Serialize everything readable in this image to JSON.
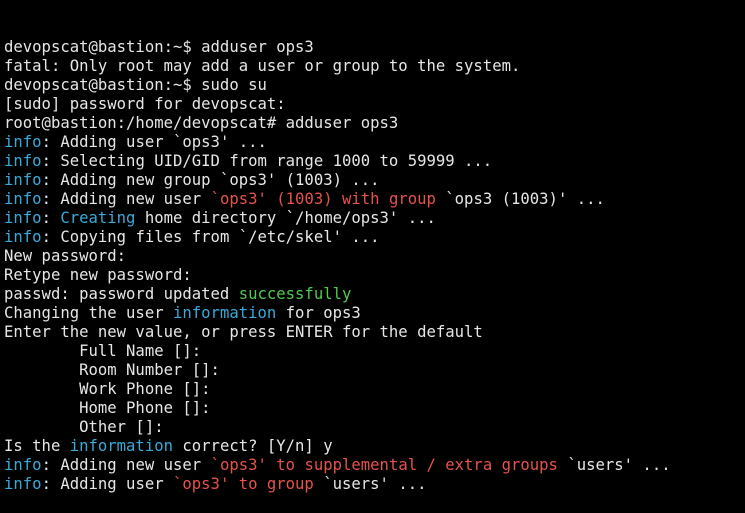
{
  "colors": {
    "background": "#000000",
    "default": "#e6e6e6",
    "info": "#3aa9d8",
    "red": "#e5534b",
    "green": "#4fc94f"
  },
  "lines": [
    [
      {
        "text": "devopscat@bastion:~$ adduser ops3",
        "c": "default"
      }
    ],
    [
      {
        "text": "fatal: Only root may add a user or group to the system.",
        "c": "default"
      }
    ],
    [
      {
        "text": "devopscat@bastion:~$ sudo su",
        "c": "default"
      }
    ],
    [
      {
        "text": "[sudo] password for devopscat:",
        "c": "default"
      }
    ],
    [
      {
        "text": "root@bastion:/home/devopscat# adduser ops3",
        "c": "default"
      }
    ],
    [
      {
        "text": "info",
        "c": "info"
      },
      {
        "text": ": Adding user `ops3' ...",
        "c": "default"
      }
    ],
    [
      {
        "text": "info",
        "c": "info"
      },
      {
        "text": ": Selecting UID/GID from range 1000 to 59999 ...",
        "c": "default"
      }
    ],
    [
      {
        "text": "info",
        "c": "info"
      },
      {
        "text": ": Adding new group `ops3' (1003) ...",
        "c": "default"
      }
    ],
    [
      {
        "text": "info",
        "c": "info"
      },
      {
        "text": ": Adding new user ",
        "c": "default"
      },
      {
        "text": "`ops3' (1003) with group ",
        "c": "red"
      },
      {
        "text": "`ops3 (1003)' ...",
        "c": "default"
      }
    ],
    [
      {
        "text": "info",
        "c": "info"
      },
      {
        "text": ": ",
        "c": "default"
      },
      {
        "text": "Creating",
        "c": "info"
      },
      {
        "text": " home directory `/home/ops3' ...",
        "c": "default"
      }
    ],
    [
      {
        "text": "info",
        "c": "info"
      },
      {
        "text": ": Copying files from `/etc/skel' ...",
        "c": "default"
      }
    ],
    [
      {
        "text": "New password:",
        "c": "default"
      }
    ],
    [
      {
        "text": "Retype new password:",
        "c": "default"
      }
    ],
    [
      {
        "text": "passwd: password updated ",
        "c": "default"
      },
      {
        "text": "successfully",
        "c": "green"
      }
    ],
    [
      {
        "text": "Changing the user ",
        "c": "default"
      },
      {
        "text": "information",
        "c": "info"
      },
      {
        "text": " for ops3",
        "c": "default"
      }
    ],
    [
      {
        "text": "Enter the new value, or press ENTER for the default",
        "c": "default"
      }
    ],
    [
      {
        "text": "        Full Name []:",
        "c": "default"
      }
    ],
    [
      {
        "text": "        Room Number []:",
        "c": "default"
      }
    ],
    [
      {
        "text": "        Work Phone []:",
        "c": "default"
      }
    ],
    [
      {
        "text": "        Home Phone []:",
        "c": "default"
      }
    ],
    [
      {
        "text": "        Other []:",
        "c": "default"
      }
    ],
    [
      {
        "text": "Is the ",
        "c": "default"
      },
      {
        "text": "information",
        "c": "info"
      },
      {
        "text": " correct? [Y/n] y",
        "c": "default"
      }
    ],
    [
      {
        "text": "info",
        "c": "info"
      },
      {
        "text": ": Adding new user ",
        "c": "default"
      },
      {
        "text": "`ops3' to supplemental / extra groups ",
        "c": "red"
      },
      {
        "text": "`users' ...",
        "c": "default"
      }
    ],
    [
      {
        "text": "info",
        "c": "info"
      },
      {
        "text": ": Adding user ",
        "c": "default"
      },
      {
        "text": "`ops3' to group ",
        "c": "red"
      },
      {
        "text": "`users' ...",
        "c": "default"
      }
    ]
  ]
}
